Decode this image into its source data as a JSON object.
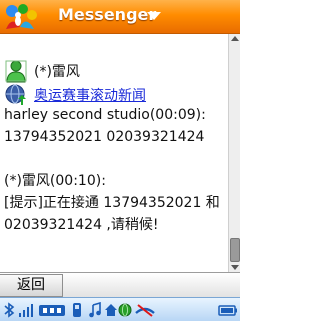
{
  "app": {
    "title": "Messenger"
  },
  "contact": {
    "name": "(*)雷风"
  },
  "news_link": {
    "label": "奥运赛事滚动新闻"
  },
  "messages": [
    {
      "header": "harley second studio(00:09):",
      "body": [
        "13794352021 02039321424"
      ]
    },
    {
      "header": "(*)雷风(00:10):",
      "body": [
        "[提示]正在接通 13794352021 和",
        "02039321424 ,请稍候!"
      ]
    }
  ],
  "softkeys": {
    "left": "返回"
  },
  "colors": {
    "title_bar": "#ff8c00",
    "link": "#1a2ad8",
    "status_bar": "#b8d6f5"
  },
  "icons": {
    "logo": "msn-butterfly-icon",
    "contact": "buddy-online-icon",
    "news": "globe-link-icon",
    "status": [
      "bluetooth-icon",
      "signal-icon",
      "pfp-icon",
      "phone-icon",
      "music-icon",
      "home-icon",
      "globe-icon",
      "missed-call-icon",
      "battery-icon"
    ]
  }
}
